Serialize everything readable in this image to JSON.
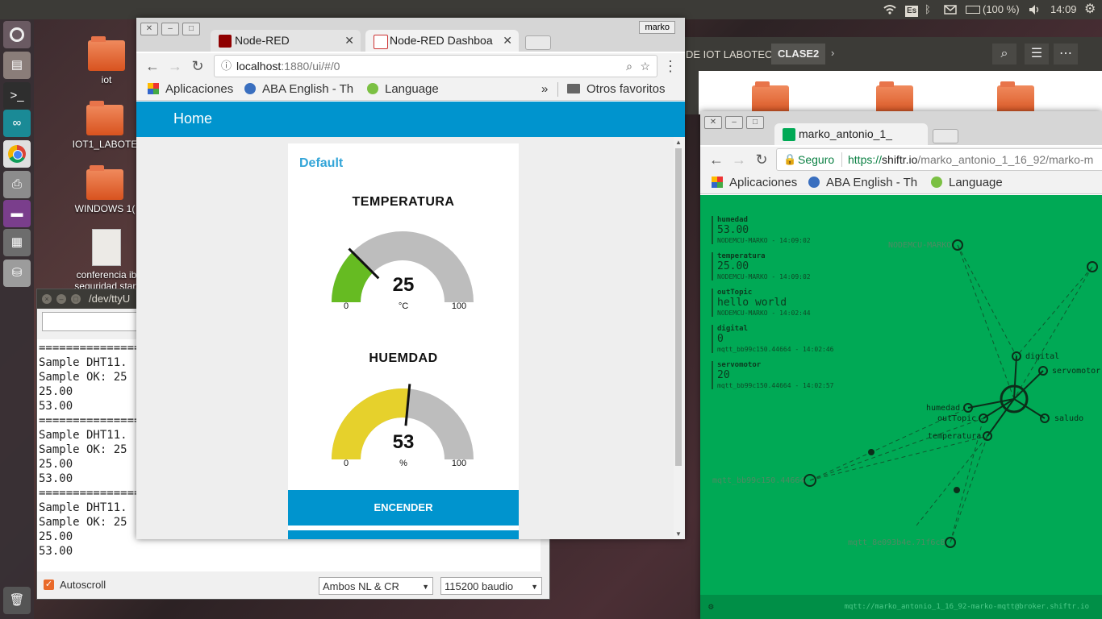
{
  "topbar": {
    "keyboard": "Es",
    "battery": "(100 %)",
    "clock": "14:09"
  },
  "desktop_icons": [
    {
      "label": "iot"
    },
    {
      "label": "IOT1_LABOTE"
    },
    {
      "label": "WINDOWS 1("
    },
    {
      "label": "conferencia ib seguridad start"
    }
  ],
  "filemanager": {
    "crumb_1": "DE IOT LABOTEC",
    "crumb_2": "CLASE2"
  },
  "serial_monitor": {
    "title": "/dev/ttyU",
    "output": "===============\nSample DHT11.\nSample OK: 25\n25.00\n53.00\n===============\nSample DHT11.\nSample OK: 25\n25.00\n53.00\n===============\nSample DHT11.\nSample OK: 25\n25.00\n53.00",
    "autoscroll_label": "Autoscroll",
    "line_ending": "Ambos NL & CR",
    "baud": "115200 baudio"
  },
  "chrome_left": {
    "user_badge": "marko",
    "tab1_label": "Node-RED",
    "tab2_label": "Node-RED Dashboa",
    "url_host": "localhost",
    "url_rest": ":1880/ui/#/0",
    "bookmarks": {
      "apps": "Aplicaciones",
      "aba": "ABA English - Th",
      "language": "Language",
      "more": "»",
      "others": "Otros favoritos"
    }
  },
  "dashboard": {
    "header_title": "Home",
    "group_title": "Default",
    "gauges": [
      {
        "title": "TEMPERATURA",
        "value": "25",
        "unit": "°C",
        "min": "0",
        "max": "100",
        "level": 0.25,
        "color": "#66bb22"
      },
      {
        "title": "HUEMDAD",
        "value": "53",
        "unit": "%",
        "min": "0",
        "max": "100",
        "level": 0.53,
        "color": "#e6d12c"
      }
    ],
    "button1_label": "ENCENDER"
  },
  "chrome_right": {
    "tab_label": "marko_antonio_1_",
    "secure_label": "Seguro",
    "url_scheme": "https://",
    "url_host": "shiftr.io",
    "url_rest": "/marko_antonio_1_16_92/marko-m",
    "bookmarks": {
      "apps": "Aplicaciones",
      "aba": "ABA English - Th",
      "language": "Language"
    }
  },
  "shiftr": {
    "messages": [
      {
        "topic": "humedad",
        "value": "53.00",
        "meta": "NODEMCU-MARKO - 14:09:02"
      },
      {
        "topic": "temperatura",
        "value": "25.00",
        "meta": "NODEMCU-MARKO - 14:09:02"
      },
      {
        "topic": "outTopic",
        "value": "hello world",
        "meta": "NODEMCU-MARKO - 14:02:44"
      },
      {
        "topic": "digital",
        "value": "0",
        "meta": "mqtt_bb99c150.44664 - 14:02:46"
      },
      {
        "topic": "servomotor",
        "value": "20",
        "meta": "mqtt_bb99c150.44664 - 14:02:57"
      }
    ],
    "graph_labels": {
      "nodemcu": "NODEMCU-MARKO",
      "digital": "digital",
      "servomotor": "servomotor",
      "humedad": "humedad",
      "outtopic": "outTopic",
      "saludo": "saludo",
      "temperatura": "temperatura",
      "mqtt1": "mqtt_bb99c150.44664",
      "mqtt2": "mqtt_8e093b4e.71f6c8"
    },
    "footer_url": "mqtt://marko_antonio_1_16_92-marko-mqtt@broker.shiftr.io"
  },
  "colors": {
    "dashboard_blue": "#0094ce",
    "shiftr_green": "#00a955",
    "gauge_track": "#bdbdbd"
  }
}
